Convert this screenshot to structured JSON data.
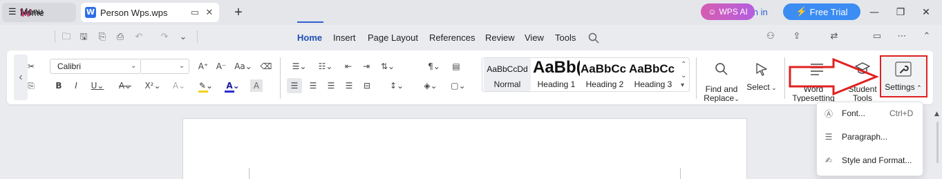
{
  "titlebar": {
    "home_tab": "Home",
    "doc_tab": "Person Wps.wps",
    "sign_in": "Sign in",
    "free_trial": "Free Trial"
  },
  "menubar": {
    "menu_label": "Menu",
    "tabs": [
      "Home",
      "Insert",
      "Page Layout",
      "References",
      "Review",
      "View",
      "Tools"
    ],
    "active_tab": "Home",
    "wps_ai": "WPS AI"
  },
  "ribbon": {
    "font_name": "Calibri",
    "font_size": "",
    "styles": [
      {
        "sample": "AaBbCcDd",
        "label": "Normal"
      },
      {
        "sample": "AaBb(",
        "label": "Heading 1"
      },
      {
        "sample": "AaBbCc",
        "label": "Heading 2"
      },
      {
        "sample": "AaBbCc",
        "label": "Heading 3"
      }
    ],
    "find_replace": "Find and Replace",
    "find": "Find and",
    "replace": "Replace",
    "select": "Select",
    "word_typesetting_1": "Word",
    "word_typesetting_2": "Typesetting",
    "student_tools_1": "Student",
    "student_tools_2": "Tools",
    "settings": "Settings"
  },
  "settings_menu": {
    "items": [
      {
        "label": "Font...",
        "shortcut": "Ctrl+D",
        "icon": "font-icon"
      },
      {
        "label": "Paragraph...",
        "shortcut": "",
        "icon": "paragraph-icon"
      },
      {
        "label": "Style and Format...",
        "shortcut": "",
        "icon": "style-format-icon"
      }
    ]
  },
  "colors": {
    "accent": "#2f5fd0",
    "free_trial_bg": "#3b8cf3",
    "highlight_red": "#e02020"
  }
}
